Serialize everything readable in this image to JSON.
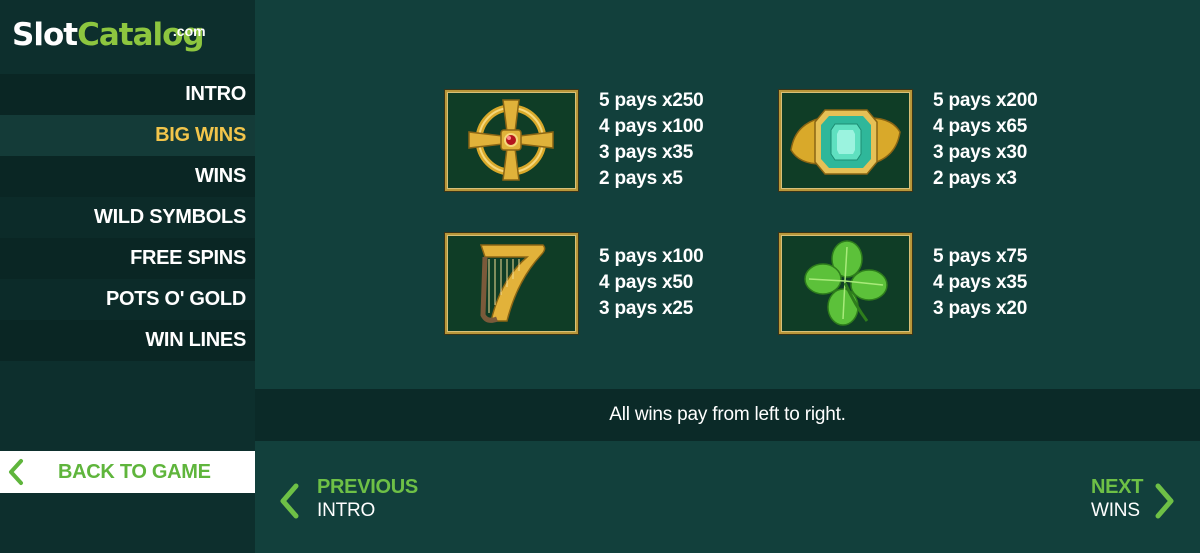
{
  "logo": {
    "slot": "Slot",
    "catalog": "Catalog",
    "suffix": ".com"
  },
  "menu": [
    {
      "label": "INTRO"
    },
    {
      "label": "BIG WINS"
    },
    {
      "label": "WINS"
    },
    {
      "label": "WILD SYMBOLS"
    },
    {
      "label": "FREE SPINS"
    },
    {
      "label": "POTS O' GOLD"
    },
    {
      "label": "WIN LINES"
    }
  ],
  "back_button": {
    "label": "BACK TO GAME",
    "icon": "chevron-left-icon"
  },
  "symbols": [
    {
      "icon": "celtic-cross-icon",
      "pays": [
        "5 pays x250",
        "4 pays x100",
        "3 pays x35",
        "2 pays x5"
      ]
    },
    {
      "icon": "emerald-gem-icon",
      "pays": [
        "5 pays x200",
        "4 pays x65",
        "3 pays x30",
        "2 pays x3"
      ]
    },
    {
      "icon": "golden-harp-icon",
      "pays": [
        "5 pays x100",
        "4 pays x50",
        "3 pays x25"
      ]
    },
    {
      "icon": "four-leaf-clover-icon",
      "pays": [
        "5 pays x75",
        "4 pays x35",
        "3 pays x20"
      ]
    }
  ],
  "note": "All wins pay from left to right.",
  "previous": {
    "title": "PREVIOUS",
    "subtitle": "INTRO"
  },
  "next": {
    "title": "NEXT",
    "subtitle": "WINS"
  },
  "colors": {
    "accent_green": "#6ec046",
    "active_gold": "#f2c54b",
    "frame_gold": "#b8973a"
  }
}
